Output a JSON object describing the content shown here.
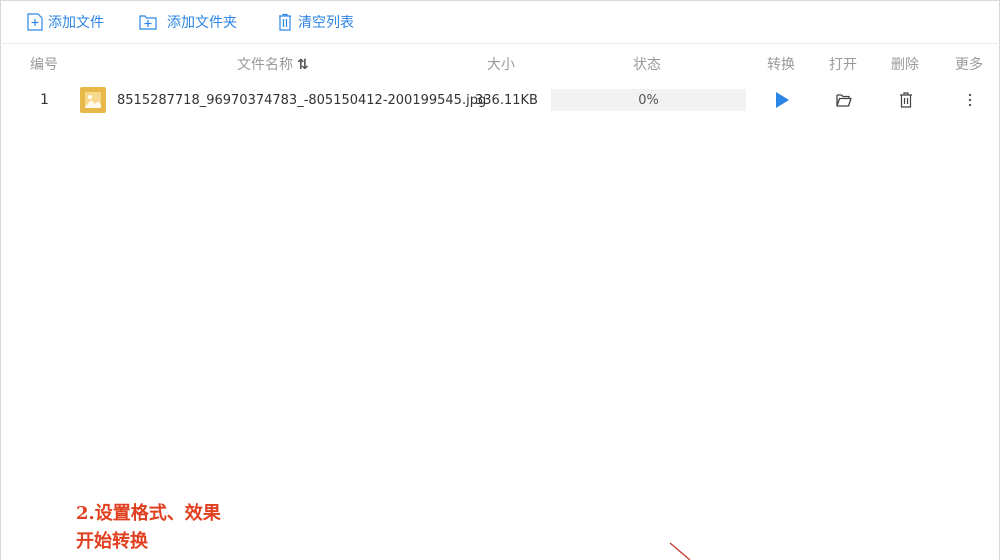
{
  "toolbar": {
    "add_file": "添加文件",
    "add_folder": "添加文件夹",
    "clear_list": "清空列表"
  },
  "columns": {
    "index": "编号",
    "name": "文件名称",
    "sort_icon": "⇅",
    "size": "大小",
    "status": "状态",
    "convert": "转换",
    "open": "打开",
    "delete": "删除",
    "more": "更多"
  },
  "files": [
    {
      "index": "1",
      "name": "8515287718_96970374783_-805150412-200199545.jpg",
      "size": "336.11KB",
      "progress_text": "0%",
      "progress": 0,
      "thumb_icon": "image-thumbnail-icon",
      "actions": [
        "play-icon",
        "folder-open-icon",
        "trash-icon",
        "more-vertical-icon"
      ]
    }
  ],
  "annotation": {
    "line1": "2.设置格式、效果",
    "line2": "开始转换"
  },
  "colors": {
    "accent": "#2c86e6",
    "annotation": "#e0401f",
    "thumb": "#e8b84a"
  }
}
